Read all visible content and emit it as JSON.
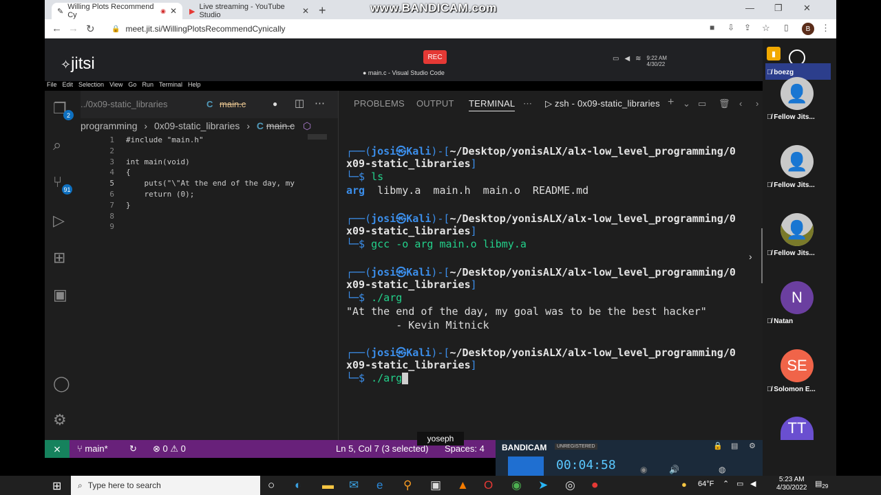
{
  "browser": {
    "tabs": [
      {
        "title": "Willing Plots Recommend Cy",
        "active": true
      },
      {
        "title": "Live streaming - YouTube Studio",
        "active": false
      }
    ],
    "url": "meet.jit.si/WillingPlotsRecommendCynically",
    "profile_initial": "B",
    "watermark": "www.BANDICAM.com"
  },
  "jitsi": {
    "logo": "jitsi",
    "rec_label": "REC",
    "participants": [
      {
        "name": "boezg",
        "initials": ""
      },
      {
        "name": "Fellow Jits...",
        "initials": ""
      },
      {
        "name": "Fellow Jits...",
        "initials": ""
      },
      {
        "name": "Fellow Jits...",
        "initials": ""
      },
      {
        "name": "Natan",
        "initials": "N",
        "color": "#6b3fa0"
      },
      {
        "name": "Solomon E...",
        "initials": "SE",
        "color": "#f06449"
      },
      {
        "name": "",
        "initials": "TT",
        "color": "#6a4fd0"
      }
    ],
    "speaker_label": "yoseph"
  },
  "remote_clock": {
    "time": "9:22 AM",
    "date": "4/30/22"
  },
  "vscode": {
    "window_title": "● main.c - Visual Studio Code",
    "menu": [
      "File",
      "Edit",
      "Selection",
      "View",
      "Go",
      "Run",
      "Terminal",
      "Help"
    ],
    "explorer_tab": "../0x09-static_libraries",
    "editor_tab": "main.c",
    "breadcrumb": [
      "programming",
      "0x09-static_libraries",
      "main.c"
    ],
    "badges": {
      "explorer": "2",
      "scm": "91"
    },
    "lines": [
      {
        "n": "1",
        "text": "#include \"main.h\""
      },
      {
        "n": "2",
        "text": ""
      },
      {
        "n": "3",
        "text": "int main(void)"
      },
      {
        "n": "4",
        "text": "{"
      },
      {
        "n": "5",
        "text": "    puts(\"\\\"At the end of the day, my"
      },
      {
        "n": "6",
        "text": "    return (0);"
      },
      {
        "n": "7",
        "text": "}"
      },
      {
        "n": "8",
        "text": ""
      },
      {
        "n": "9",
        "text": ""
      }
    ],
    "panel_tabs": [
      "PROBLEMS",
      "OUTPUT",
      "TERMINAL"
    ],
    "terminal_name": "zsh - 0x09-static_libraries",
    "terminal": {
      "prompt_user": "josi㉿Kali",
      "path1": "~/Desktop/yonisALX/alx-low_level_programming/0",
      "path2": "x09-static_libraries",
      "cmd1": "ls",
      "ls_out_dir": "arg",
      "ls_out_rest": "  libmy.a  main.h  main.o  README.md",
      "cmd2": "gcc -o arg main.o libmy.a",
      "cmd3": "./arg",
      "out1": "\"At the end of the day, my goal was to be the best hacker\"",
      "out2": "        - Kevin Mitnick",
      "cmd4": "./arg"
    },
    "status": {
      "branch": "main*",
      "errors": "0",
      "warnings": "0",
      "position": "Ln 5, Col 7 (3 selected)",
      "spaces": "Spaces: 4"
    }
  },
  "bandicam": {
    "logo": "BANDICAM",
    "unregistered": "UNREGISTERED",
    "timer": "00:04:58"
  },
  "taskbar": {
    "search_placeholder": "Type here to search",
    "weather": "64°F",
    "time": "5:23 AM",
    "date": "4/30/2022",
    "notif_count": "29"
  }
}
